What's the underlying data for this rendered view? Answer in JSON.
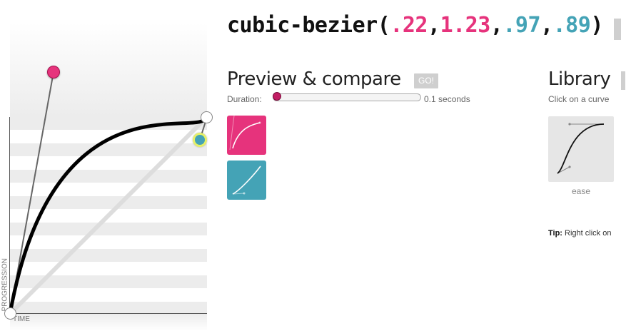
{
  "header": {
    "prefix": "cubic-bezier(",
    "p1x": ".22",
    "p1y": "1.23",
    "p2x": ".97",
    "p2y": ".89",
    "suffix": ")",
    "sep": ","
  },
  "editor": {
    "time_label": "TIME",
    "progression_label": "PROGRESSION",
    "curve": {
      "x1": 0.22,
      "y1": 1.23,
      "x2": 0.97,
      "y2": 0.89
    }
  },
  "preview": {
    "title": "Preview & compare",
    "go_label": "GO!",
    "duration_label": "Duration:",
    "duration_value": "0.1 seconds",
    "duration_slider_fraction": 0.02
  },
  "library": {
    "title": "Library",
    "hint": "Click on a curve",
    "items": [
      {
        "label": "ease"
      }
    ],
    "tip_label": "Tip:",
    "tip_text": " Right click on"
  },
  "colors": {
    "accent_pink": "#e6337c",
    "accent_teal": "#44a3b6",
    "slider": "#c21e64"
  }
}
